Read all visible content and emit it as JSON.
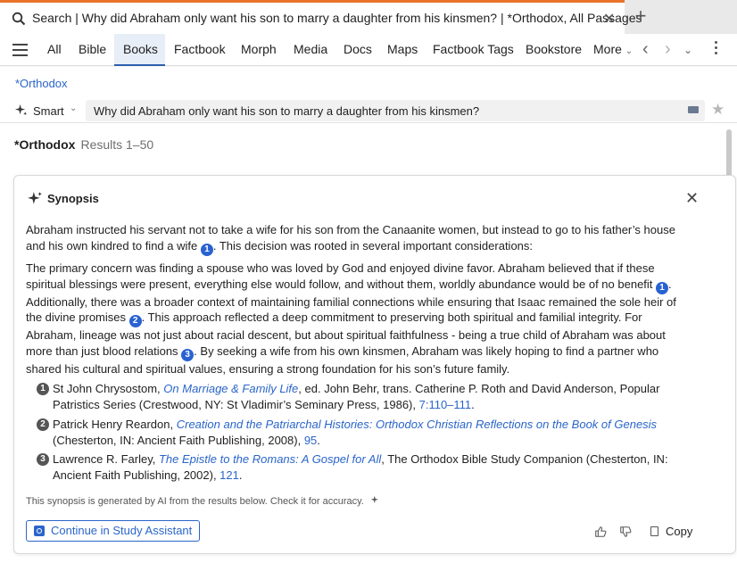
{
  "tab": {
    "title": "Search | Why did Abraham only want his son to marry a daughter from his kinsmen? | *Orthodox, All Passages",
    "close": "✕",
    "new_tab": "+"
  },
  "nav": {
    "items": [
      "All",
      "Bible",
      "Books",
      "Factbook",
      "Morph",
      "Media",
      "Docs",
      "Maps",
      "Factbook Tags",
      "Bookstore",
      "More"
    ],
    "active": "Books",
    "more_chevron": "⌄"
  },
  "library_link": "*Orthodox",
  "query": {
    "mode": "Smart",
    "value": "Why did Abraham only want his son to marry a daughter from his kinsmen?"
  },
  "results": {
    "library": "*Orthodox",
    "count": "Results 1–50"
  },
  "synopsis": {
    "title": "Synopsis",
    "p1": {
      "a": "Abraham instructed his servant not to take a wife for his son from the Canaanite women, but instead to go to his father’s house and his own kindred to find a wife",
      "c1": "1",
      "b": ". This decision was rooted in several important considerations:"
    },
    "p2": {
      "a": "The primary concern was finding a spouse who was loved by God and enjoyed divine favor. Abraham believed that if these spiritual blessings were present, everything else would follow, and without them, worldly abundance would be of no benefit",
      "c1": "1",
      "b": ". Additionally, there was a broader context of maintaining familial connections while ensuring that Isaac remained the sole heir of the divine promises",
      "c2": "2",
      "c": ". This approach reflected a deep commitment to preserving both spiritual and familial integrity. For Abraham, lineage was not just about racial descent, but about spiritual faithfulness - being a true child of Abraham was about more than just blood relations",
      "c3": "3",
      "d": ". By seeking a wife from his own kinsmen, Abraham was likely hoping to find a partner who shared his cultural and spiritual values, ensuring a strong foundation for his son’s future family."
    },
    "references": [
      {
        "num": "1",
        "author": "St John Chrysostom, ",
        "title": "On Marriage & Family Life",
        "rest": ", ed. John Behr, trans. Catherine P. Roth and David Anderson, Popular Patristics Series (Crestwood, NY: St Vladimir’s Seminary Press, 1986), ",
        "page": "7:110–111",
        "end": "."
      },
      {
        "num": "2",
        "author": "Patrick Henry Reardon, ",
        "title": "Creation and the Patriarchal Histories: Orthodox Christian Reflections on the Book of Genesis",
        "rest": " (Chesterton, IN: Ancient Faith Publishing, 2008), ",
        "page": "95",
        "end": "."
      },
      {
        "num": "3",
        "author": "Lawrence R. Farley, ",
        "title": "The Epistle to the Romans: A Gospel for All",
        "rest": ", The Orthodox Bible Study Companion (Chesterton, IN: Ancient Faith Publishing, 2002), ",
        "page": "121",
        "end": "."
      }
    ],
    "disclaimer": "This synopsis is generated by AI from the results below. Check it for accuracy.",
    "study_button": "Continue in Study Assistant",
    "copy_label": "Copy"
  },
  "colors": {
    "accent": "#2a65c9",
    "tab_highlight": "#e8742a",
    "citation": "#2962d2"
  }
}
